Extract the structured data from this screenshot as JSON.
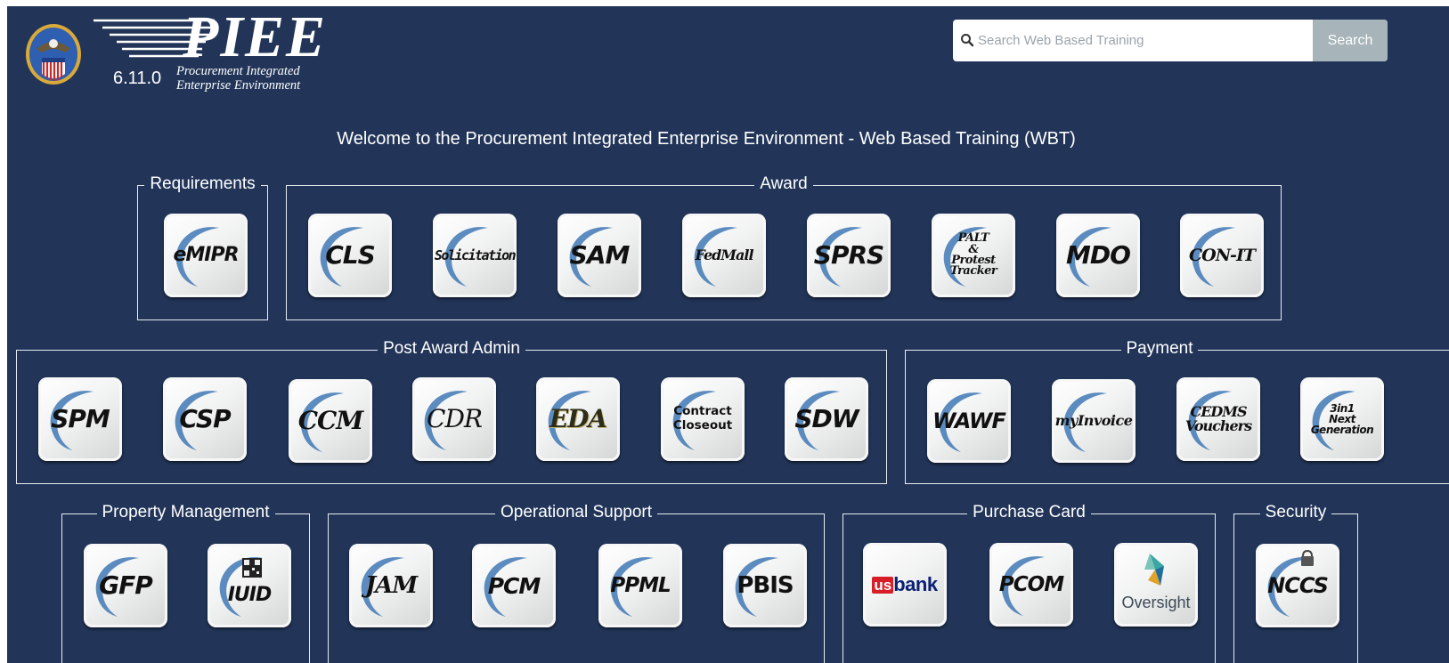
{
  "header": {
    "version": "6.11.0",
    "logo_text": "PIEE",
    "logo_subtitle_line1": "Procurement Integrated",
    "logo_subtitle_line2": "Enterprise Environment"
  },
  "search": {
    "placeholder": "Search Web Based Training",
    "value": "",
    "button_label": "Search"
  },
  "welcome": "Welcome to the Procurement Integrated Enterprise Environment - Web Based Training (WBT)",
  "colors": {
    "background": "#223559",
    "search_button": "#a7b4ba",
    "usbank_red": "#d71e28",
    "usbank_blue": "#0c2074"
  },
  "sections": [
    {
      "title": "Requirements",
      "tiles": [
        {
          "label": "eMIPR"
        }
      ]
    },
    {
      "title": "Award",
      "tiles": [
        {
          "label": "CLS"
        },
        {
          "label": "Solicitation"
        },
        {
          "label": "SAM"
        },
        {
          "label": "FedMall"
        },
        {
          "label": "SPRS"
        },
        {
          "label": "PALT\n&\nProtest\nTracker"
        },
        {
          "label": "MDO"
        },
        {
          "label": "CON-IT"
        }
      ]
    },
    {
      "title": "Post Award Admin",
      "tiles": [
        {
          "label": "SPM"
        },
        {
          "label": "CSP"
        },
        {
          "label": "CCM"
        },
        {
          "label": "CDR"
        },
        {
          "label": "EDA"
        },
        {
          "label": "Contract\nCloseout"
        },
        {
          "label": "SDW"
        }
      ]
    },
    {
      "title": "Payment",
      "tiles": [
        {
          "label": "WAWF"
        },
        {
          "label": "myInvoice"
        },
        {
          "label": "CEDMS\nVouchers"
        },
        {
          "label": "3in1\nNext\nGeneration"
        }
      ]
    },
    {
      "title": "Property Management",
      "tiles": [
        {
          "label": "GFP"
        },
        {
          "label": "IUID"
        }
      ]
    },
    {
      "title": "Operational Support",
      "tiles": [
        {
          "label": "JAM"
        },
        {
          "label": "PCM"
        },
        {
          "label": "PPML"
        },
        {
          "label": "PBIS"
        }
      ]
    },
    {
      "title": "Purchase Card",
      "tiles": [
        {
          "label": "PCOM"
        },
        {
          "label": "Oversight"
        }
      ],
      "usbank": {
        "us": "us",
        "bank": "bank"
      }
    },
    {
      "title": "Security",
      "tiles": [
        {
          "label": "NCCS"
        }
      ]
    }
  ]
}
